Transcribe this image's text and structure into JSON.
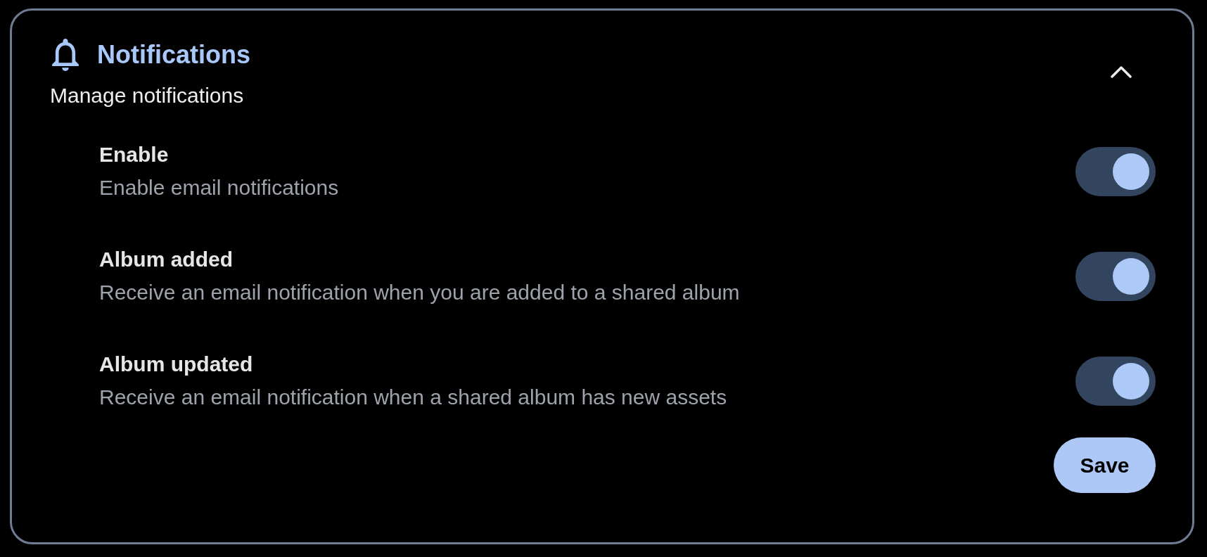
{
  "section": {
    "title": "Notifications",
    "subtitle": "Manage notifications",
    "expanded": true
  },
  "settings": [
    {
      "title": "Enable",
      "description": "Enable email notifications",
      "on": true
    },
    {
      "title": "Album added",
      "description": "Receive an email notification when you are added to a shared album",
      "on": true
    },
    {
      "title": "Album updated",
      "description": "Receive an email notification when a shared album has new assets",
      "on": true
    }
  ],
  "save_button": {
    "label": "Save"
  }
}
